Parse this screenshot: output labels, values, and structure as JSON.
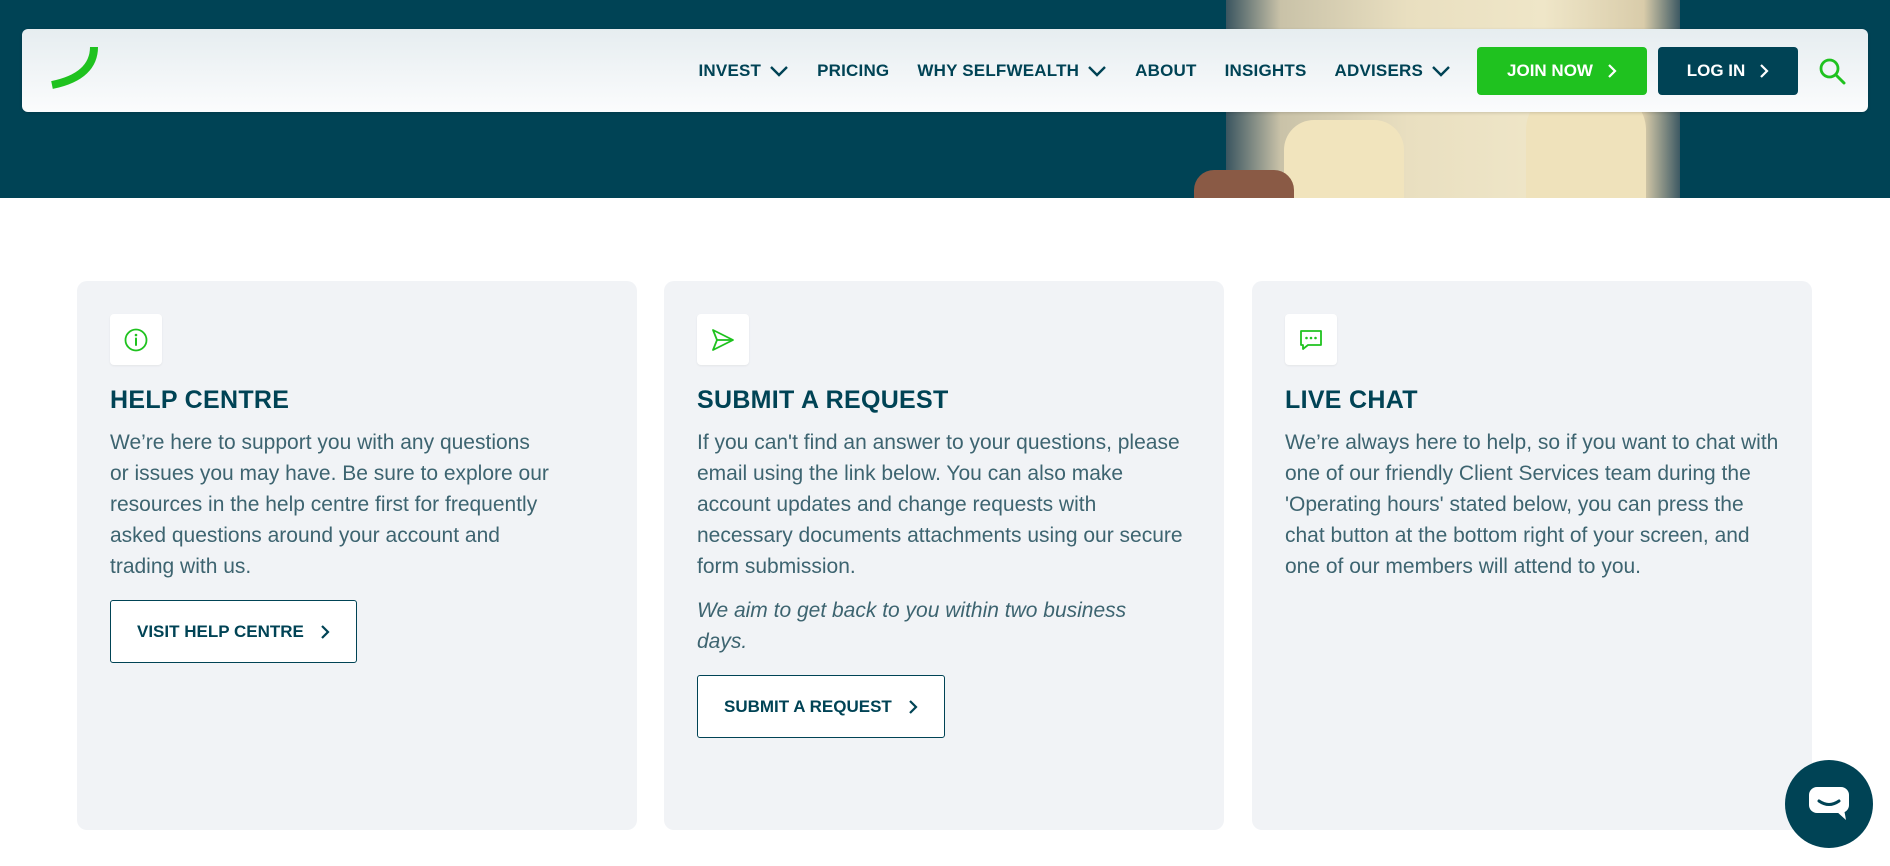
{
  "colors": {
    "brand_green": "#1fc21f",
    "brand_dark": "#004355",
    "card_bg": "#f1f3f6",
    "body_text": "#3d6470"
  },
  "nav": {
    "logo_icon": "swoosh-logo-icon",
    "items": [
      {
        "label": "INVEST",
        "has_dropdown": true
      },
      {
        "label": "PRICING",
        "has_dropdown": false
      },
      {
        "label": "WHY SELFWEALTH",
        "has_dropdown": true
      },
      {
        "label": "ABOUT",
        "has_dropdown": false
      },
      {
        "label": "INSIGHTS",
        "has_dropdown": false
      },
      {
        "label": "ADVISERS",
        "has_dropdown": true
      }
    ],
    "join_label": "JOIN NOW",
    "login_label": "LOG IN",
    "search_icon": "search-icon"
  },
  "cards": [
    {
      "icon": "info-icon",
      "title": "HELP CENTRE",
      "body": "We’re here to support you with any questions or issues you may have. Be sure to explore our resources in the help centre first for frequently asked questions around your account and trading with us.",
      "button_label": "VISIT HELP CENTRE"
    },
    {
      "icon": "send-icon",
      "title": "SUBMIT A REQUEST",
      "body": "If you can't find an answer to your questions, please email using the link below. You can also make account updates and change requests with necessary documents attachments using our secure form submission.",
      "note": "We aim to get back to you within two business days.",
      "button_label": "SUBMIT A REQUEST"
    },
    {
      "icon": "chat-icon",
      "title": "LIVE CHAT",
      "body": "We’re always here to help, so if you want to chat with one of our friendly Client Services team during the 'Operating hours' stated below, you can press the chat button at the bottom right of your screen, and one of our members will attend to you."
    }
  ],
  "chat_widget": {
    "icon": "chat-bubble-icon"
  }
}
